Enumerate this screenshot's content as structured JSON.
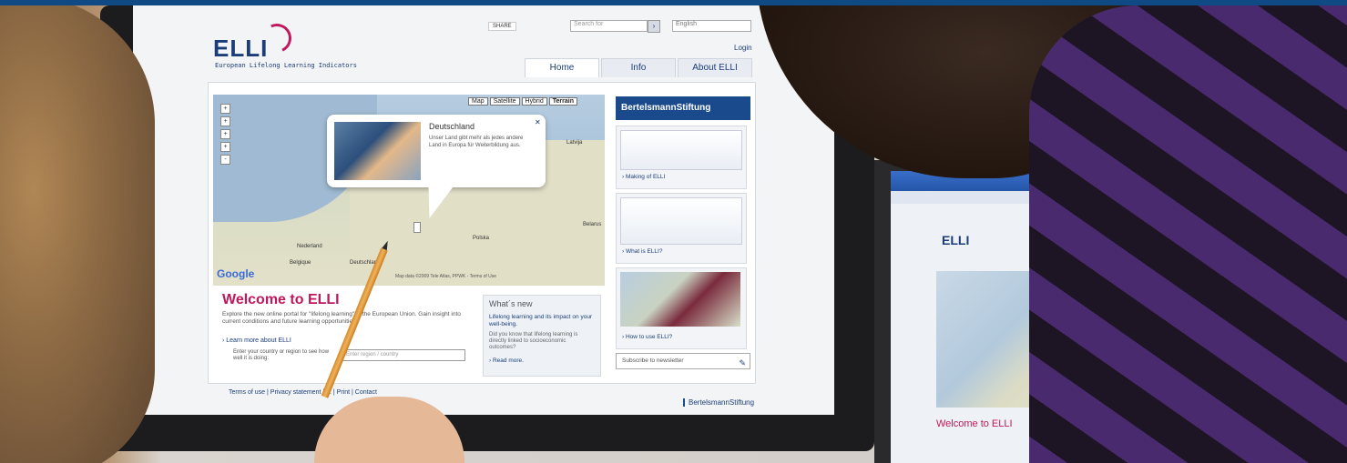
{
  "header": {
    "logo": "ELLI",
    "tagline": "European Lifelong Learning Indicators",
    "share_label": "SHARE",
    "search_placeholder": "Search for",
    "search_button": "›",
    "language": "English",
    "login": "Login"
  },
  "tabs": [
    {
      "label": "Home",
      "active": true
    },
    {
      "label": "Info",
      "active": false
    },
    {
      "label": "About ELLI",
      "active": false
    }
  ],
  "map": {
    "buttons": [
      "Map",
      "Satellite",
      "Hybrid",
      "Terrain"
    ],
    "selected": "Terrain",
    "zoom_controls": [
      "+",
      "+",
      "+",
      "+",
      "-"
    ],
    "labels": [
      "Nederland",
      "Belgique",
      "Deutschland",
      "Polska",
      "Latvija",
      "Belarus"
    ],
    "provider": "Google",
    "copyright": "Map data ©2009 Tele Atlas, PPWK - Terms of Use",
    "popup": {
      "title": "Deutschland",
      "text": "Unser Land gibt mehr als jedes andere Land in Europa für Weiterbildung aus.",
      "close": "✕"
    }
  },
  "welcome": {
    "title": "Welcome to ELLI",
    "text": "Explore the new online portal for \"lifelong learning\" in the European Union. Gain insight into current conditions and future learning opportunities.",
    "learn_more": "› Learn more about ELLI",
    "enter_label": "Enter your country or region to see how well it is doing:",
    "region_placeholder": "Enter region / country"
  },
  "whats_new": {
    "title": "What´s new",
    "headline": "Lifelong learning and its impact on your well-being.",
    "body": "Did you know that lifelong learning is directly linked to socioeconomic outcomes?",
    "read_more": "› Read more."
  },
  "sidebar": {
    "brand": "BertelsmannStiftung",
    "cards": [
      {
        "label": "› Making of ELLI"
      },
      {
        "label": "› What is ELLI?"
      },
      {
        "label": "› How to use ELLI?"
      }
    ],
    "newsletter": "Subscribe to newsletter",
    "newsletter_icon": "✎"
  },
  "footer": {
    "links": "Terms of use  |  Privacy statement  |  ...  |  Print  |  Contact",
    "brand": "BertelsmannStiftung"
  },
  "second_screen": {
    "logo": "ELLI",
    "welcome": "Welcome to ELLI"
  }
}
